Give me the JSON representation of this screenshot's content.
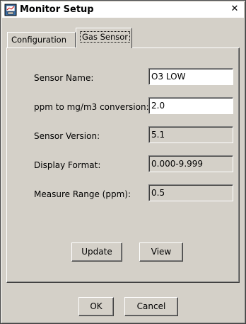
{
  "window": {
    "title": "Monitor Setup",
    "close_glyph": "✕",
    "icon": "monitor-setup-icon"
  },
  "tabs": [
    {
      "label": "Configuration",
      "selected": false
    },
    {
      "label": "Gas Sensor",
      "selected": true
    }
  ],
  "gas_sensor": {
    "fields": [
      {
        "label": "Sensor Name:",
        "value": "O3 LOW",
        "editable": true
      },
      {
        "label": "ppm to mg/m3 conversion:",
        "value": "2.0",
        "editable": true
      },
      {
        "label": "Sensor Version:",
        "value": "5.1",
        "editable": false
      },
      {
        "label": "Display Format:",
        "value": "0.000-9.999",
        "editable": false
      },
      {
        "label": "Measure Range (ppm):",
        "value": "0.5",
        "editable": false
      }
    ],
    "update_label": "Update",
    "view_label": "View"
  },
  "footer": {
    "ok_label": "OK",
    "cancel_label": "Cancel"
  }
}
